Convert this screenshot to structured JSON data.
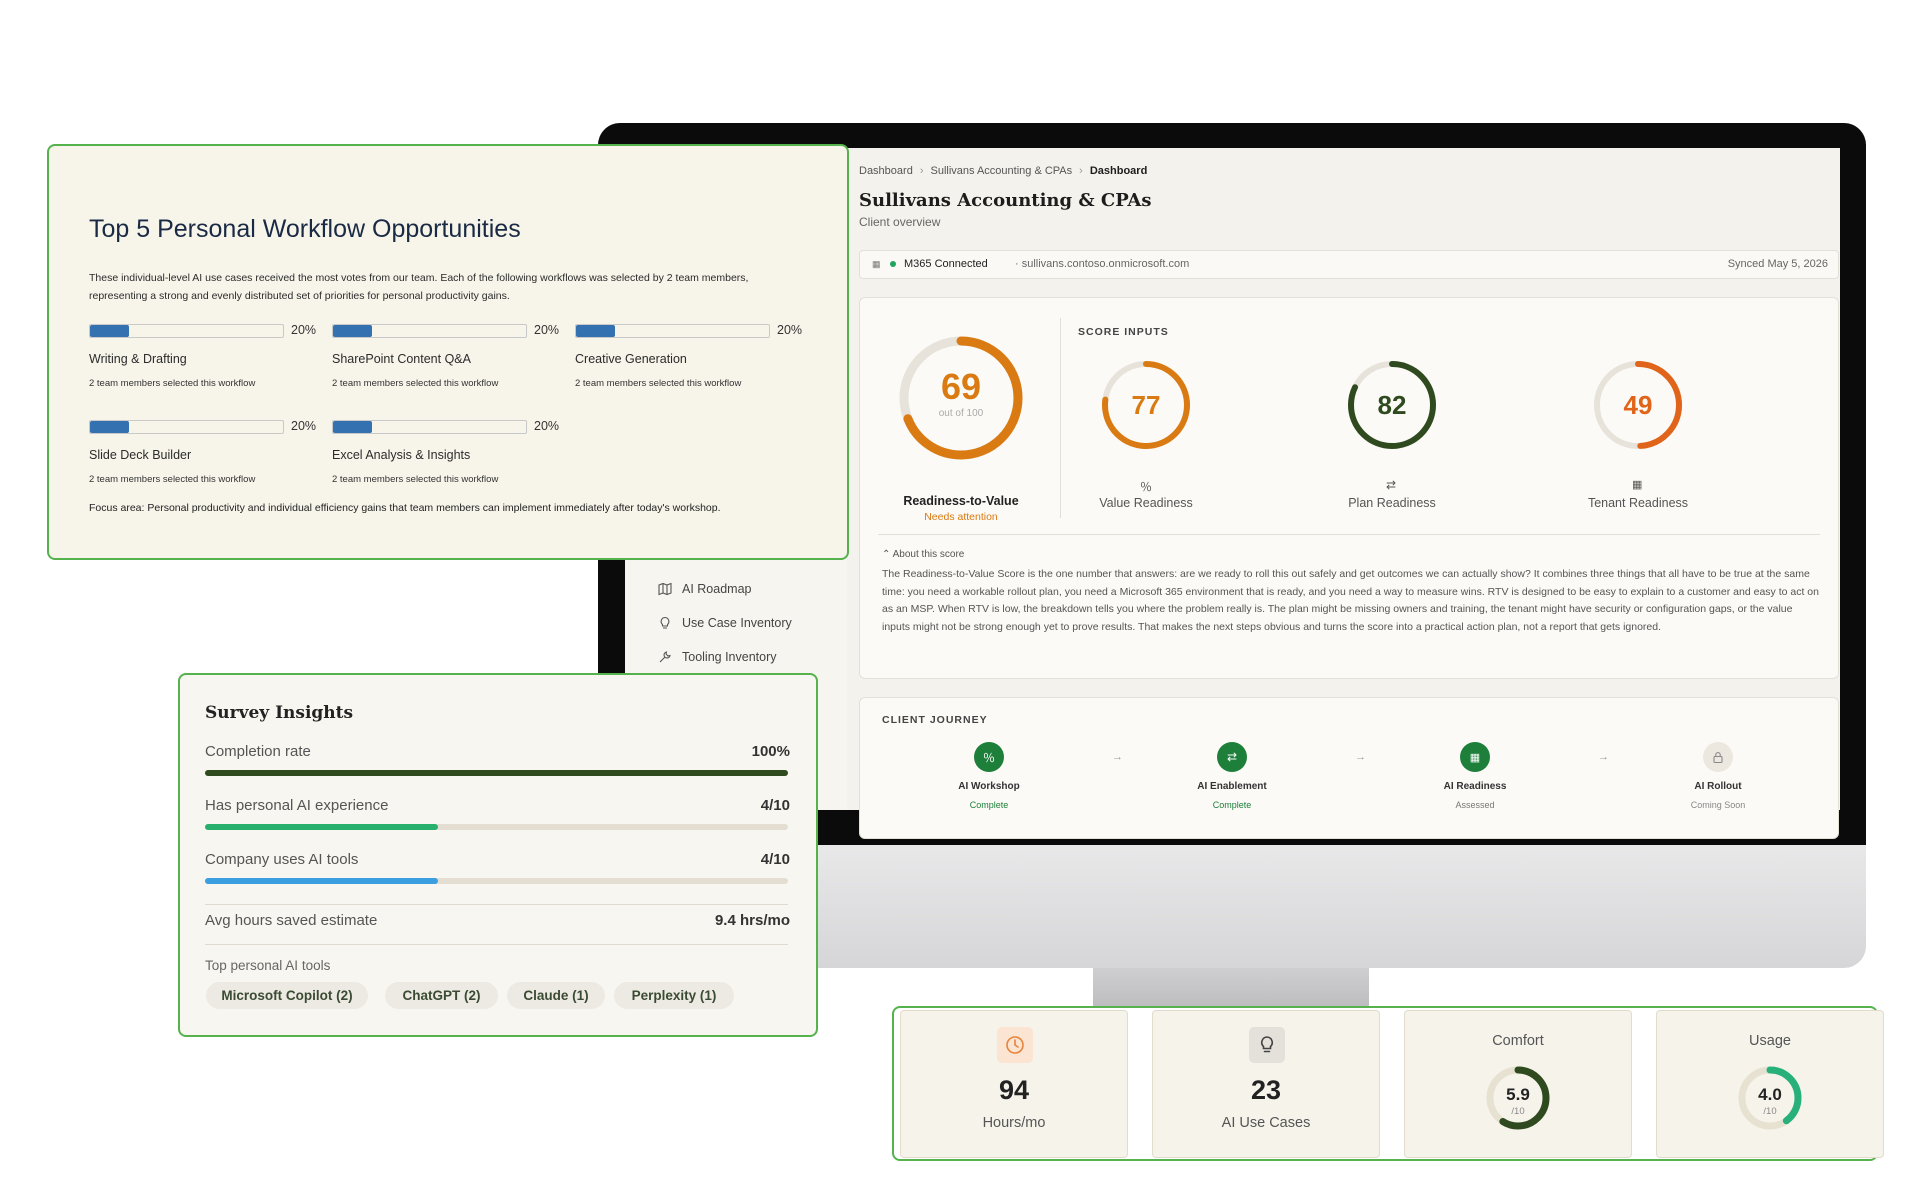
{
  "breadcrumb": [
    "Dashboard",
    "Sullivans Accounting & CPAs",
    "Dashboard"
  ],
  "client": {
    "title": "Sullivans Accounting & CPAs",
    "subtitle": "Client overview"
  },
  "m365": {
    "status": "M365 Connected",
    "domain": "· sullivans.contoso.onmicrosoft.com",
    "synced": "Synced May 5, 2026"
  },
  "sidebar": {
    "items": [
      {
        "label": "AI Roadmap",
        "icon": "map-icon"
      },
      {
        "label": "Use Case Inventory",
        "icon": "lightbulb-icon"
      },
      {
        "label": "Tooling Inventory",
        "icon": "wrench-icon"
      }
    ]
  },
  "rtv": {
    "value": "69",
    "value_num": 69,
    "out_of": "out of 100",
    "label": "Readiness-to-Value",
    "status": "Needs attention",
    "color": "#d97a12"
  },
  "score_inputs": {
    "caption": "SCORE INPUTS",
    "items": [
      {
        "value": "77",
        "value_num": 77,
        "label": "Value Readiness",
        "color": "#d97a12",
        "icon": "percent-icon"
      },
      {
        "value": "82",
        "value_num": 82,
        "label": "Plan Readiness",
        "color": "#2f4a1f",
        "icon": "flow-icon"
      },
      {
        "value": "49",
        "value_num": 49,
        "label": "Tenant Readiness",
        "color": "#e0641a",
        "icon": "grid-icon"
      }
    ]
  },
  "about": {
    "toggle": "About this score",
    "text": "The Readiness-to-Value Score is the one number that answers: are we ready to roll this out safely and get outcomes we can actually show? It combines three things that all have to be true at the same time: you need a workable rollout plan, you need a Microsoft 365 environment that is ready, and you need a way to measure wins. RTV is designed to be easy to explain to a customer and easy to act on as an MSP. When RTV is low, the breakdown tells you where the problem really is. The plan might be missing owners and training, the tenant might have security or configuration gaps, or the value inputs might not be strong enough yet to prove results. That makes the next steps obvious and turns the score into a practical action plan, not a report that gets ignored."
  },
  "journey": {
    "caption": "CLIENT JOURNEY",
    "steps": [
      {
        "name": "AI Workshop",
        "status": "Complete",
        "state": "done",
        "icon": "percent-icon"
      },
      {
        "name": "AI Enablement",
        "status": "Complete",
        "state": "done",
        "icon": "flow-icon"
      },
      {
        "name": "AI Readiness",
        "status": "Assessed",
        "state": "done",
        "icon": "grid-icon"
      },
      {
        "name": "AI Rollout",
        "status": "Coming Soon",
        "state": "locked",
        "icon": "lock-icon"
      }
    ]
  },
  "workflows": {
    "title": "Top 5 Personal Workflow Opportunities",
    "description": "These individual-level AI use cases received the most votes from our team. Each of the following workflows was selected by 2 team members, representing a strong and evenly distributed set of priorities for personal productivity gains.",
    "items": [
      {
        "name": "Writing & Drafting",
        "pct": "20%",
        "pct_num": 20,
        "count": "2 team members selected this workflow"
      },
      {
        "name": "SharePoint Content Q&A",
        "pct": "20%",
        "pct_num": 20,
        "count": "2 team members selected this workflow"
      },
      {
        "name": "Creative Generation",
        "pct": "20%",
        "pct_num": 20,
        "count": "2 team members selected this workflow"
      },
      {
        "name": "Slide Deck Builder",
        "pct": "20%",
        "pct_num": 20,
        "count": "2 team members selected this workflow"
      },
      {
        "name": "Excel Analysis & Insights",
        "pct": "20%",
        "pct_num": 20,
        "count": "2 team members selected this workflow"
      }
    ],
    "focus": "Focus area: Personal productivity and individual efficiency gains that team members can implement immediately after today's workshop."
  },
  "survey": {
    "title": "Survey Insights",
    "rows": [
      {
        "label": "Completion rate",
        "value": "100%",
        "fraction": 1.0,
        "color": "#2f4a1f"
      },
      {
        "label": "Has personal AI experience",
        "value": "4/10",
        "fraction": 0.4,
        "color": "#27b06b"
      },
      {
        "label": "Company uses AI tools",
        "value": "4/10",
        "fraction": 0.4,
        "color": "#3a9ee0"
      }
    ],
    "hours_label": "Avg hours saved estimate",
    "hours_value": "9.4 hrs/mo",
    "tools_label": "Top personal AI tools",
    "tools": [
      "Microsoft Copilot (2)",
      "ChatGPT (2)",
      "Claude (1)",
      "Perplexity (1)"
    ]
  },
  "stats": {
    "hours": {
      "value": "94",
      "label": "Hours/mo",
      "icon": "clock-icon",
      "color": "#e8843a"
    },
    "use_cases": {
      "value": "23",
      "label": "AI Use Cases",
      "icon": "lightbulb-icon"
    },
    "comfort": {
      "title": "Comfort",
      "value": "5.9",
      "fraction": 0.59,
      "scale": "/10",
      "color": "#2f4a1f"
    },
    "usage": {
      "title": "Usage",
      "value": "4.0",
      "fraction": 0.4,
      "scale": "/10",
      "color": "#27b07a"
    }
  }
}
